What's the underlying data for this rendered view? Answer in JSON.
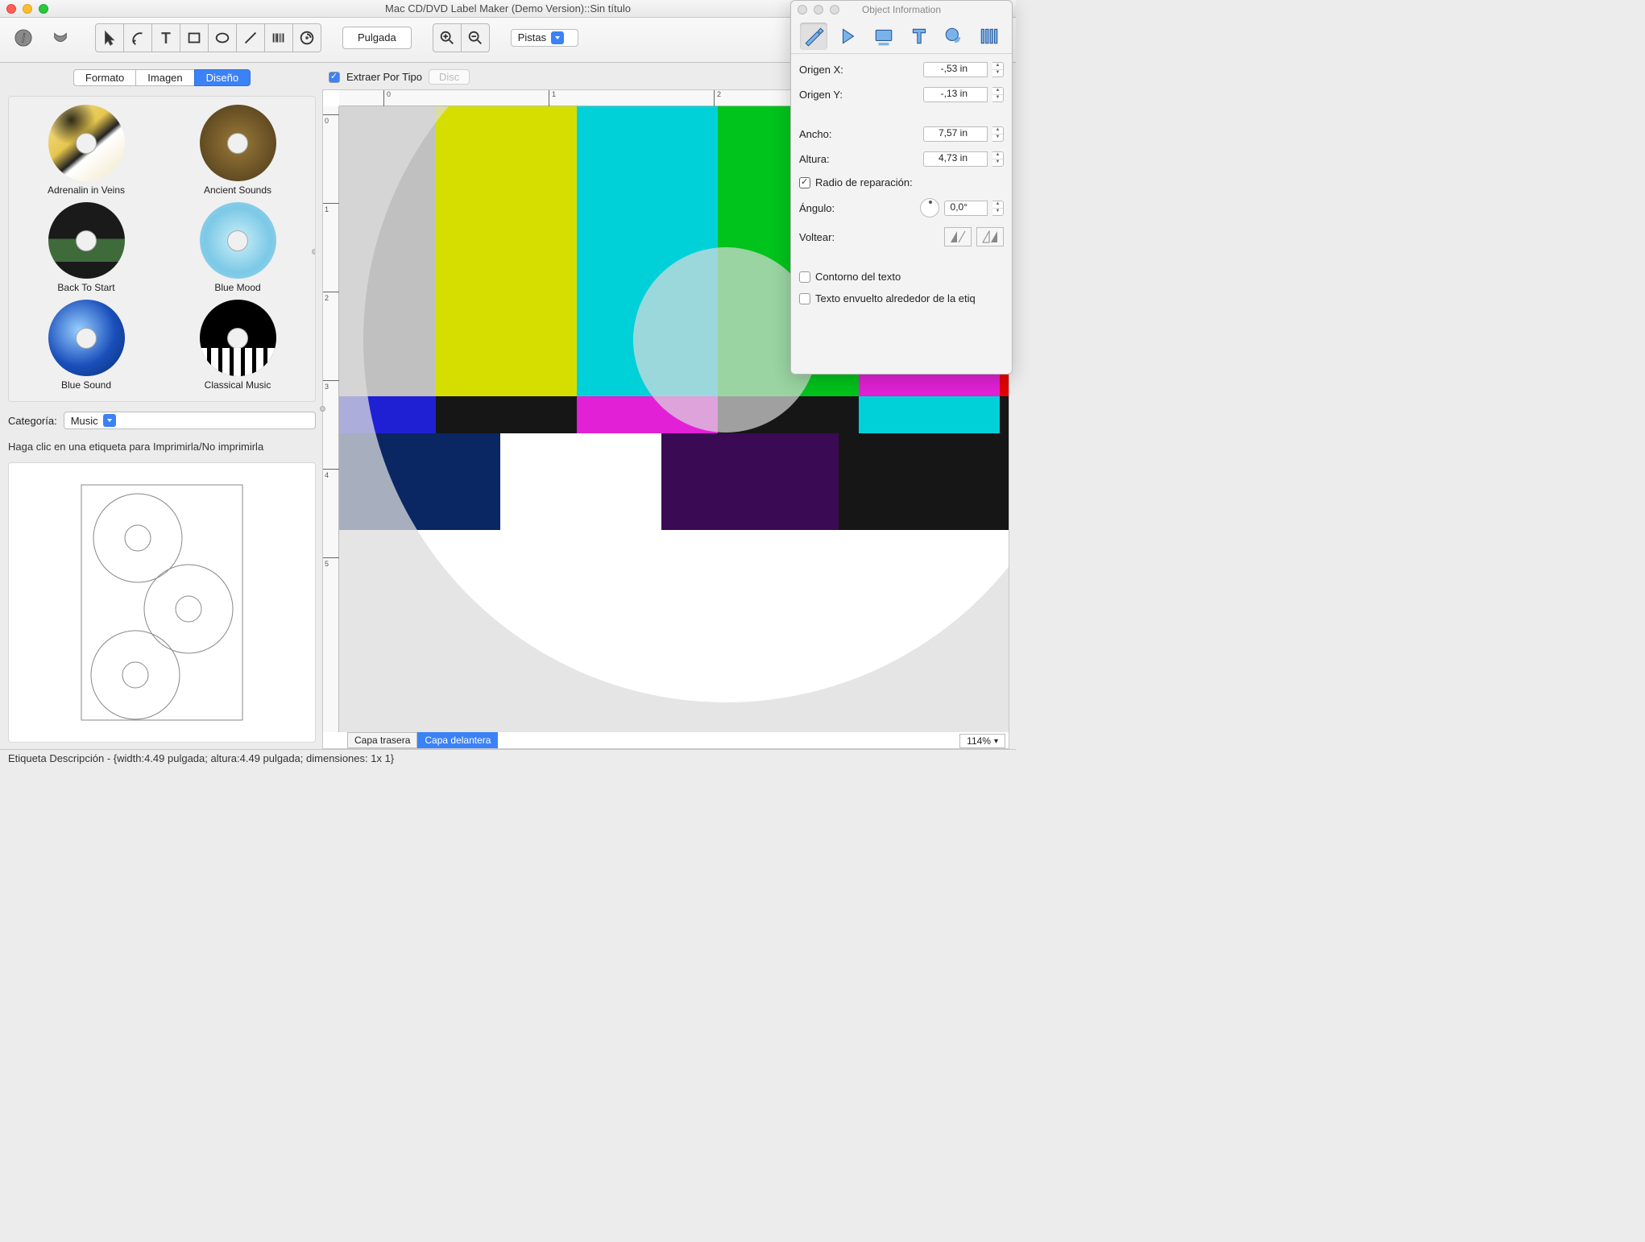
{
  "window": {
    "title": "Mac CD/DVD Label Maker (Demo Version)::Sin título"
  },
  "toolbar": {
    "unit_button": "Pulgada",
    "dropdown": "Pistas"
  },
  "left": {
    "tabs": {
      "formato": "Formato",
      "imagen": "Imagen",
      "diseno": "Diseño"
    },
    "designs": [
      "Adrenalin in Veins",
      "Ancient Sounds",
      "Back To Start",
      "Blue Mood",
      "Blue Sound",
      "Classical Music"
    ],
    "categoria_label": "Categoría:",
    "categoria_value": "Music",
    "hint": "Haga clic en una etiqueta para Imprimirla/No imprimirla"
  },
  "extract": {
    "checkbox_label": "Extraer Por Tipo",
    "disc_button": "Disc"
  },
  "ruler": {
    "h": [
      "0",
      "1",
      "2"
    ],
    "v": [
      "0",
      "1",
      "2",
      "3",
      "4",
      "5"
    ]
  },
  "layers": {
    "back": "Capa trasera",
    "front": "Capa delantera"
  },
  "zoom": "114%",
  "status": "Etiqueta Descripción - {width:4.49 pulgada; altura:4.49 pulgada; dimensiones: 1x 1}",
  "inspector": {
    "title": "Object Information",
    "origin_x_label": "Origen X:",
    "origin_x": "-,53 in",
    "origin_y_label": "Origen Y:",
    "origin_y": "-,13 in",
    "ancho_label": "Ancho:",
    "ancho": "7,57 in",
    "altura_label": "Altura:",
    "altura": "4,73 in",
    "ratio_label": "Radio de reparación:",
    "angulo_label": "Ángulo:",
    "angulo": "0,0°",
    "voltear_label": "Voltear:",
    "contorno": "Contorno del texto",
    "envuelto": "Texto envuelto alrededor de la etiq"
  }
}
